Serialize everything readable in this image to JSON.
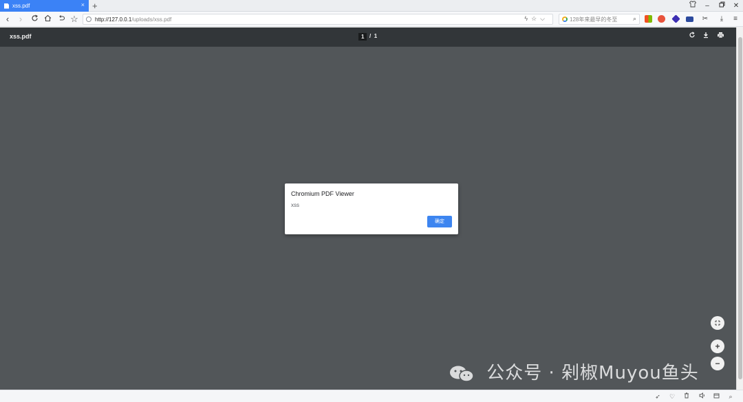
{
  "browser": {
    "tab_title": "xss.pdf",
    "tab_close": "×",
    "new_tab": "+",
    "address": {
      "host": "http://127.0.0.1",
      "path": "/uploads/xss.pdf"
    },
    "search_placeholder": "128年来最早的冬至",
    "window_controls": [
      "minimize",
      "restore",
      "close"
    ]
  },
  "pdf_viewer": {
    "file_name": "xss.pdf",
    "current_page": "1",
    "page_separator": "/",
    "total_pages": "1",
    "tools": [
      "rotate-icon",
      "download-icon",
      "print-icon"
    ]
  },
  "dialog": {
    "title": "Chromium PDF Viewer",
    "message": "xss",
    "ok_label": "确定",
    "ok_color": "#3d85f0"
  },
  "watermark": {
    "text": "公众号 · 剁椒Muyou鱼头"
  },
  "colors": {
    "tab_active": "#3b82f6",
    "pdf_toolbar": "#323639",
    "pdf_background": "#525659"
  }
}
